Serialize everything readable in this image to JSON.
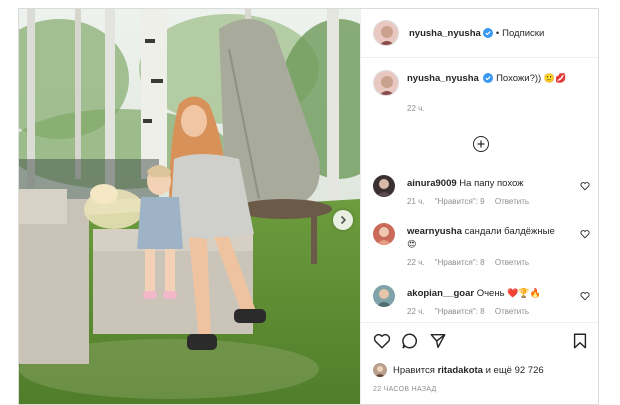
{
  "post": {
    "username": "nyusha_nyusha",
    "follow_label": "Подписки",
    "dot": "•",
    "caption": "Похожи?))",
    "caption_emoji": "🙂💋",
    "caption_time": "22 ч."
  },
  "comments": [
    {
      "username": "ainura9009",
      "text": "На папу похож",
      "emoji": "",
      "time": "21 ч.",
      "likes": "\"Нравится\": 9",
      "reply": "Ответить"
    },
    {
      "username": "wearnyusha",
      "text": "сандали балдёжные",
      "emoji": "😍",
      "time": "22 ч.",
      "likes": "\"Нравится\": 8",
      "reply": "Ответить"
    },
    {
      "username": "akopian__goar",
      "text": "Очень",
      "emoji": "❤️🏆🔥",
      "time": "22 ч.",
      "likes": "\"Нравится\": 8",
      "reply": "Ответить"
    }
  ],
  "likes": {
    "prefix": "Нравится",
    "user": "ritadakota",
    "suffix": "и ещё 92 726"
  },
  "timestamp": "22 ЧАСОВ НАЗАД",
  "icons": [
    "heart-icon",
    "comment-icon",
    "share-icon",
    "bookmark-icon",
    "plus-circle-icon",
    "chevron-right-icon",
    "verified-badge-icon"
  ],
  "colors": {
    "verified": "#3897f0",
    "meta": "#8e8e8e",
    "border": "#dbdbdb"
  }
}
